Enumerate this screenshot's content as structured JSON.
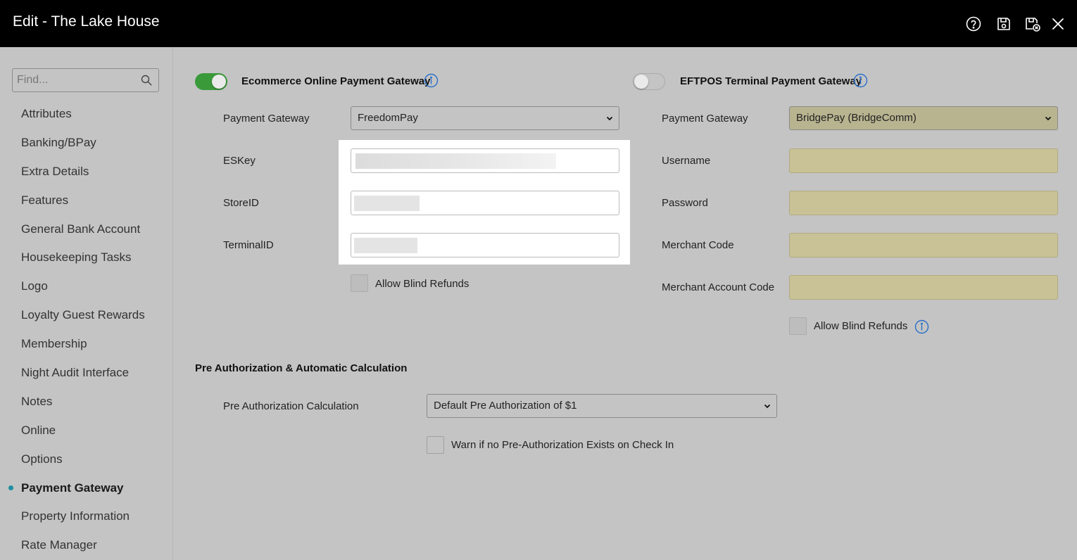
{
  "window": {
    "title": "Edit - The Lake House",
    "icons": [
      "help-icon",
      "save-icon",
      "save-close-icon",
      "close-icon"
    ]
  },
  "sidebar": {
    "search_placeholder": "Find...",
    "items": [
      {
        "label": "Attributes"
      },
      {
        "label": "Banking/BPay"
      },
      {
        "label": "Extra Details"
      },
      {
        "label": "Features"
      },
      {
        "label": "General Bank Account"
      },
      {
        "label": "Housekeeping Tasks"
      },
      {
        "label": "Logo"
      },
      {
        "label": "Loyalty Guest Rewards"
      },
      {
        "label": "Membership"
      },
      {
        "label": "Night Audit Interface"
      },
      {
        "label": "Notes"
      },
      {
        "label": "Online"
      },
      {
        "label": "Options"
      },
      {
        "label": "Payment Gateway",
        "active": true
      },
      {
        "label": "Property Information"
      },
      {
        "label": "Rate Manager"
      }
    ]
  },
  "ecommerce": {
    "heading": "Ecommerce Online Payment Gateway",
    "enabled": true,
    "payment_gateway_label": "Payment Gateway",
    "payment_gateway_value": "FreedomPay",
    "eskey_label": "ESKey",
    "storeid_label": "StoreID",
    "terminalid_label": "TerminalID",
    "allow_blind_refunds_label": "Allow Blind Refunds"
  },
  "eftpos": {
    "heading": "EFTPOS Terminal Payment Gateway",
    "enabled": false,
    "payment_gateway_label": "Payment Gateway",
    "payment_gateway_value": "BridgePay (BridgeComm)",
    "username_label": "Username",
    "password_label": "Password",
    "merchant_code_label": "Merchant Code",
    "merchant_account_code_label": "Merchant Account Code",
    "allow_blind_refunds_label": "Allow Blind Refunds"
  },
  "preauth": {
    "heading": "Pre Authorization & Automatic Calculation",
    "calculation_label": "Pre Authorization Calculation",
    "calculation_value": "Default Pre Authorization of $1",
    "warn_label": "Warn if no Pre-Authorization Exists on Check In"
  },
  "colors": {
    "titlebar": "#000000",
    "background": "#c4c4c4",
    "toggle_on": "#3a9a3a",
    "active_dot": "#1e8fa0",
    "info_icon": "#2a6fc9",
    "disabled_field": "#c9c296"
  }
}
